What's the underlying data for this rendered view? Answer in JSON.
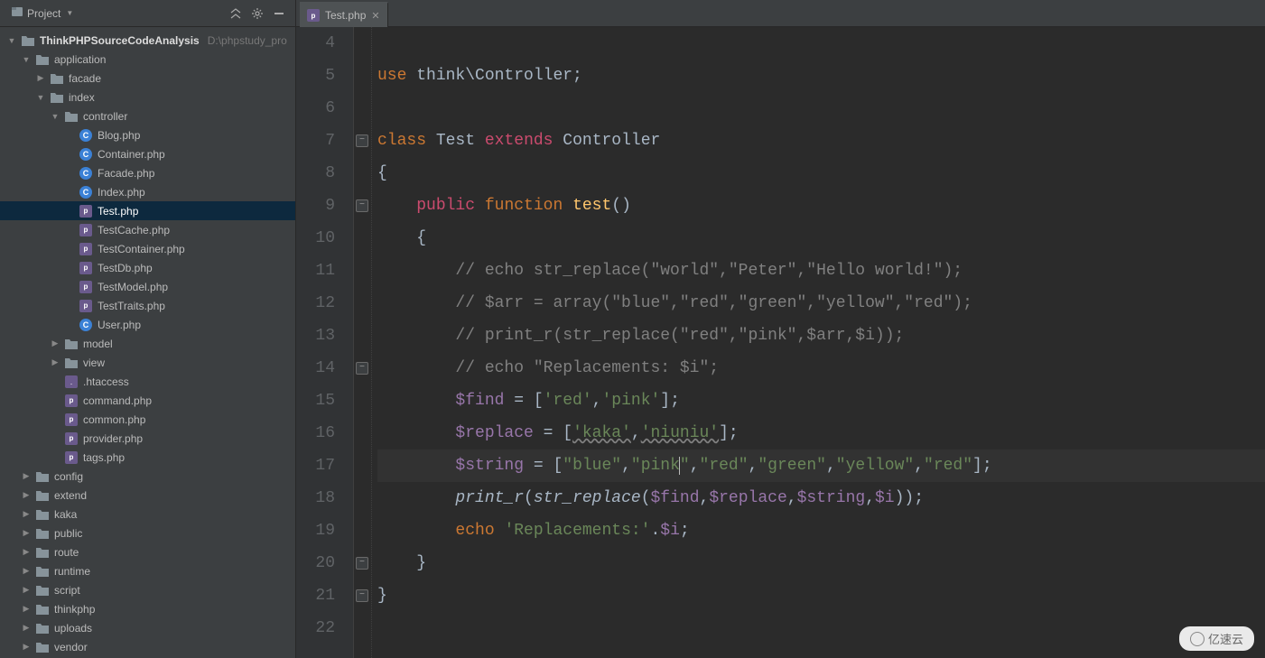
{
  "sidebar_header": {
    "project_label": "Project",
    "collapse_tip": "Collapse All",
    "settings_tip": "Settings",
    "hide_tip": "Hide"
  },
  "editor_tab": {
    "label": "Test.php"
  },
  "root": {
    "name": "ThinkPHPSourceCodeAnalysis",
    "path": "D:\\phpstudy_pro"
  },
  "tree": [
    {
      "depth": 0,
      "arrow": "down",
      "icon": "folder-root",
      "label": "ThinkPHPSourceCodeAnalysis",
      "path": "D:\\phpstudy_pro",
      "bold": true
    },
    {
      "depth": 1,
      "arrow": "down",
      "icon": "folder",
      "label": "application"
    },
    {
      "depth": 2,
      "arrow": "right",
      "icon": "folder",
      "label": "facade"
    },
    {
      "depth": 2,
      "arrow": "down",
      "icon": "folder",
      "label": "index"
    },
    {
      "depth": 3,
      "arrow": "down",
      "icon": "folder",
      "label": "controller"
    },
    {
      "depth": 4,
      "arrow": "none",
      "icon": "php-c",
      "label": "Blog.php"
    },
    {
      "depth": 4,
      "arrow": "none",
      "icon": "php-c",
      "label": "Container.php"
    },
    {
      "depth": 4,
      "arrow": "none",
      "icon": "php-c",
      "label": "Facade.php"
    },
    {
      "depth": 4,
      "arrow": "none",
      "icon": "php-c",
      "label": "Index.php"
    },
    {
      "depth": 4,
      "arrow": "none",
      "icon": "php-file",
      "label": "Test.php",
      "selected": true
    },
    {
      "depth": 4,
      "arrow": "none",
      "icon": "php-file",
      "label": "TestCache.php"
    },
    {
      "depth": 4,
      "arrow": "none",
      "icon": "php-file",
      "label": "TestContainer.php"
    },
    {
      "depth": 4,
      "arrow": "none",
      "icon": "php-file",
      "label": "TestDb.php"
    },
    {
      "depth": 4,
      "arrow": "none",
      "icon": "php-file",
      "label": "TestModel.php"
    },
    {
      "depth": 4,
      "arrow": "none",
      "icon": "php-file",
      "label": "TestTraits.php"
    },
    {
      "depth": 4,
      "arrow": "none",
      "icon": "php-c",
      "label": "User.php"
    },
    {
      "depth": 3,
      "arrow": "right",
      "icon": "folder",
      "label": "model"
    },
    {
      "depth": 3,
      "arrow": "right",
      "icon": "folder",
      "label": "view"
    },
    {
      "depth": 3,
      "arrow": "none",
      "icon": "dotfile",
      "label": ".htaccess"
    },
    {
      "depth": 3,
      "arrow": "none",
      "icon": "php-file",
      "label": "command.php"
    },
    {
      "depth": 3,
      "arrow": "none",
      "icon": "php-file",
      "label": "common.php"
    },
    {
      "depth": 3,
      "arrow": "none",
      "icon": "php-file",
      "label": "provider.php"
    },
    {
      "depth": 3,
      "arrow": "none",
      "icon": "php-file",
      "label": "tags.php"
    },
    {
      "depth": 1,
      "arrow": "right",
      "icon": "folder",
      "label": "config"
    },
    {
      "depth": 1,
      "arrow": "right",
      "icon": "folder",
      "label": "extend"
    },
    {
      "depth": 1,
      "arrow": "right",
      "icon": "folder",
      "label": "kaka"
    },
    {
      "depth": 1,
      "arrow": "right",
      "icon": "folder",
      "label": "public"
    },
    {
      "depth": 1,
      "arrow": "right",
      "icon": "folder",
      "label": "route"
    },
    {
      "depth": 1,
      "arrow": "right",
      "icon": "folder",
      "label": "runtime"
    },
    {
      "depth": 1,
      "arrow": "right",
      "icon": "folder",
      "label": "script"
    },
    {
      "depth": 1,
      "arrow": "right",
      "icon": "folder",
      "label": "thinkphp"
    },
    {
      "depth": 1,
      "arrow": "right",
      "icon": "folder",
      "label": "uploads"
    },
    {
      "depth": 1,
      "arrow": "right",
      "icon": "folder",
      "label": "vendor"
    }
  ],
  "code_lines": {
    "start": 4,
    "fold_marks": [
      7,
      9,
      14,
      20,
      21
    ],
    "current_line": 17,
    "caret_after_col": "pink",
    "lines": [
      {
        "n": 4,
        "html": ""
      },
      {
        "n": 5,
        "html": "<span class='tok-kw'>use</span> <span class='tok-class'>think\\Controller</span><span class='tok-punc'>;</span>"
      },
      {
        "n": 6,
        "html": ""
      },
      {
        "n": 7,
        "html": "<span class='tok-kw'>class</span> <span class='tok-class'>Test</span> <span class='tok-kw2'>extends</span> <span class='tok-class'>Controller</span>"
      },
      {
        "n": 8,
        "html": "<span class='tok-punc'>{</span>"
      },
      {
        "n": 9,
        "html": "    <span class='tok-kw2'>public</span> <span class='tok-kw'>function</span> <span class='tok-def'>test</span><span class='tok-punc'>()</span>"
      },
      {
        "n": 10,
        "html": "    <span class='tok-punc'>{</span>"
      },
      {
        "n": 11,
        "html": "        <span class='tok-comment'>// echo str_replace(\"world\",\"Peter\",\"Hello world!\");</span>"
      },
      {
        "n": 12,
        "html": "        <span class='tok-comment'>// $arr = array(\"blue\",\"red\",\"green\",\"yellow\",\"red\");</span>"
      },
      {
        "n": 13,
        "html": "        <span class='tok-comment'>// print_r(str_replace(\"red\",\"pink\",$arr,$i));</span>"
      },
      {
        "n": 14,
        "html": "        <span class='tok-comment'>// echo \"Replacements: $i\";</span>"
      },
      {
        "n": 15,
        "html": "        <span class='tok-var'>$find</span> <span class='tok-punc'>= [</span><span class='tok-str'>'red'</span><span class='tok-punc'>,</span><span class='tok-str'>'pink'</span><span class='tok-punc'>];</span>"
      },
      {
        "n": 16,
        "html": "        <span class='tok-var'>$replace</span> <span class='tok-punc'>= [</span><span class='tok-str-bad'>'kaka'</span><span class='tok-punc'>,</span><span class='tok-str-bad'>'niuniu'</span><span class='tok-punc'>];</span>"
      },
      {
        "n": 17,
        "html": "        <span class='tok-var'>$string</span> <span class='tok-punc'>= [</span><span class='tok-str'>\"blue\"</span><span class='tok-punc'>,</span><span class='tok-str'>\"pink<span class='cursor-caret'></span>\"</span><span class='tok-punc'>,</span><span class='tok-str'>\"red\"</span><span class='tok-punc'>,</span><span class='tok-str'>\"green\"</span><span class='tok-punc'>,</span><span class='tok-str'>\"yellow\"</span><span class='tok-punc'>,</span><span class='tok-str'>\"red\"</span><span class='tok-punc'>];</span>"
      },
      {
        "n": 18,
        "html": "        <span class='tok-fn'>print_r</span><span class='tok-punc'>(</span><span class='tok-fn'>str_replace</span><span class='tok-punc'>(</span><span class='tok-var'>$find</span><span class='tok-punc'>,</span><span class='tok-var'>$replace</span><span class='tok-punc'>,</span><span class='tok-var'>$string</span><span class='tok-punc'>,</span><span class='tok-var'>$i</span><span class='tok-punc'>));</span>"
      },
      {
        "n": 19,
        "html": "        <span class='tok-kw'>echo</span> <span class='tok-str'>'Replacements:'</span><span class='tok-punc'>.</span><span class='tok-var'>$i</span><span class='tok-punc'>;</span>"
      },
      {
        "n": 20,
        "html": "    <span class='tok-punc'>}</span>"
      },
      {
        "n": 21,
        "html": "<span class='tok-punc'>}</span>"
      },
      {
        "n": 22,
        "html": ""
      }
    ]
  },
  "watermark": "亿速云"
}
